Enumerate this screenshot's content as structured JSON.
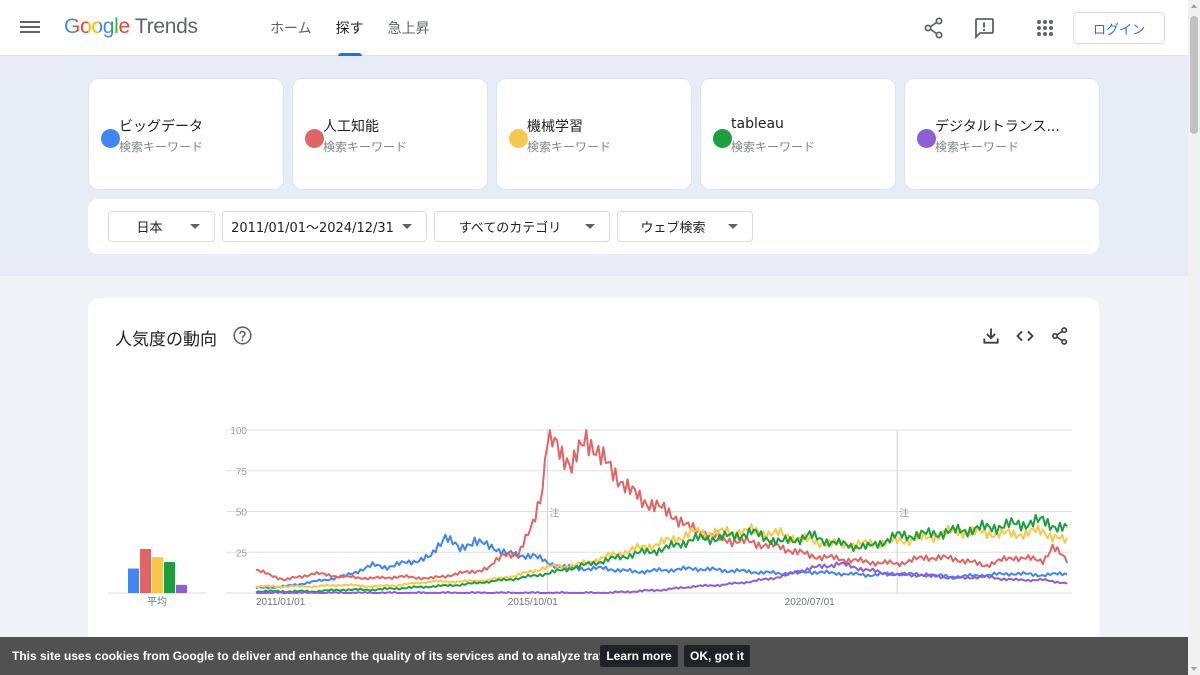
{
  "header": {
    "logo_google": "Google",
    "logo_trends": "Trends",
    "nav": [
      {
        "label": "ホーム"
      },
      {
        "label": "探す"
      },
      {
        "label": "急上昇"
      }
    ],
    "login_label": "ログイン"
  },
  "terms": [
    {
      "name": "ビッグデータ",
      "sub": "検索キーワード",
      "color": "#4285f4"
    },
    {
      "name": "人工知能",
      "sub": "検索キーワード",
      "color": "#e06666"
    },
    {
      "name": "機械学習",
      "sub": "検索キーワード",
      "color": "#f6c94e"
    },
    {
      "name": "tableau",
      "sub": "検索キーワード",
      "color": "#1e9e3e"
    },
    {
      "name": "デジタルトランス...",
      "sub": "検索キーワード",
      "color": "#8c5fd3"
    }
  ],
  "filters": {
    "region": "日本",
    "date_range": "2011/01/01～2024/12/31",
    "category": "すべてのカテゴリ",
    "search_type": "ウェブ検索"
  },
  "chart_card": {
    "title": "人気度の動向"
  },
  "chart_data": {
    "type": "line",
    "y_ticks": [
      "100",
      "75",
      "50",
      "25"
    ],
    "x_tick_labels": [
      "2011/01/01",
      "2015/10/01",
      "2020/07/01"
    ],
    "ylim": [
      0,
      100
    ],
    "grid": true,
    "notes": [
      {
        "label": "注",
        "date": "2016/01"
      },
      {
        "label": "注",
        "date": "2022/01"
      }
    ],
    "average_label": "平均",
    "averages": [
      {
        "series": "ビッグデータ",
        "value": 15
      },
      {
        "series": "人工知能",
        "value": 27
      },
      {
        "series": "機械学習",
        "value": 22
      },
      {
        "series": "tableau",
        "value": 19
      },
      {
        "series": "デジタルトランス...",
        "value": 5
      }
    ],
    "series": [
      {
        "name": "ビッグデータ",
        "color": "#4285f4",
        "points": [
          [
            "2011/01",
            3
          ],
          [
            "2011/07",
            4
          ],
          [
            "2012/01",
            7
          ],
          [
            "2012/07",
            10
          ],
          [
            "2013/01",
            17
          ],
          [
            "2013/04",
            16
          ],
          [
            "2013/07",
            18
          ],
          [
            "2014/01",
            22
          ],
          [
            "2014/04",
            36
          ],
          [
            "2014/07",
            26
          ],
          [
            "2014/10",
            33
          ],
          [
            "2015/01",
            28
          ],
          [
            "2015/04",
            26
          ],
          [
            "2015/07",
            22
          ],
          [
            "2015/10",
            24
          ],
          [
            "2016/01",
            18
          ],
          [
            "2016/07",
            15
          ],
          [
            "2017/01",
            15
          ],
          [
            "2017/07",
            13
          ],
          [
            "2018/01",
            14
          ],
          [
            "2018/07",
            15
          ],
          [
            "2019/01",
            14
          ],
          [
            "2019/07",
            13
          ],
          [
            "2020/01",
            12
          ],
          [
            "2020/07",
            13
          ],
          [
            "2021/01",
            12
          ],
          [
            "2021/07",
            11
          ],
          [
            "2022/01",
            12
          ],
          [
            "2022/07",
            11
          ],
          [
            "2023/01",
            10
          ],
          [
            "2023/07",
            11
          ],
          [
            "2024/01",
            12
          ],
          [
            "2024/07",
            11
          ],
          [
            "2024/12",
            12
          ]
        ]
      },
      {
        "name": "人工知能",
        "color": "#e06666",
        "points": [
          [
            "2011/01",
            14
          ],
          [
            "2011/07",
            8
          ],
          [
            "2012/01",
            12
          ],
          [
            "2012/07",
            10
          ],
          [
            "2013/01",
            9
          ],
          [
            "2013/07",
            10
          ],
          [
            "2014/01",
            9
          ],
          [
            "2014/07",
            12
          ],
          [
            "2015/01",
            15
          ],
          [
            "2015/04",
            25
          ],
          [
            "2015/07",
            22
          ],
          [
            "2015/10",
            45
          ],
          [
            "2015/12",
            62
          ],
          [
            "2016/01",
            92
          ],
          [
            "2016/03",
            94
          ],
          [
            "2016/06",
            75
          ],
          [
            "2016/09",
            98
          ],
          [
            "2016/12",
            82
          ],
          [
            "2017/03",
            74
          ],
          [
            "2017/06",
            62
          ],
          [
            "2017/09",
            57
          ],
          [
            "2017/12",
            52
          ],
          [
            "2018/03",
            48
          ],
          [
            "2018/06",
            40
          ],
          [
            "2018/09",
            37
          ],
          [
            "2019/01",
            33
          ],
          [
            "2019/07",
            31
          ],
          [
            "2020/01",
            28
          ],
          [
            "2020/07",
            23
          ],
          [
            "2021/01",
            21
          ],
          [
            "2021/07",
            19
          ],
          [
            "2022/01",
            18
          ],
          [
            "2022/07",
            22
          ],
          [
            "2023/01",
            21
          ],
          [
            "2023/07",
            17
          ],
          [
            "2024/01",
            22
          ],
          [
            "2024/07",
            20
          ],
          [
            "2024/09",
            28
          ],
          [
            "2024/12",
            20
          ]
        ]
      },
      {
        "name": "機械学習",
        "color": "#f6c94e",
        "points": [
          [
            "2011/01",
            4
          ],
          [
            "2011/07",
            4
          ],
          [
            "2012/01",
            4
          ],
          [
            "2012/07",
            5
          ],
          [
            "2013/01",
            4
          ],
          [
            "2013/07",
            5
          ],
          [
            "2014/01",
            7
          ],
          [
            "2014/07",
            7
          ],
          [
            "2015/01",
            8
          ],
          [
            "2015/07",
            11
          ],
          [
            "2016/01",
            16
          ],
          [
            "2016/07",
            17
          ],
          [
            "2017/01",
            22
          ],
          [
            "2017/07",
            27
          ],
          [
            "2018/01",
            31
          ],
          [
            "2018/07",
            37
          ],
          [
            "2019/01",
            37
          ],
          [
            "2019/07",
            38
          ],
          [
            "2020/01",
            36
          ],
          [
            "2020/07",
            32
          ],
          [
            "2021/01",
            30
          ],
          [
            "2021/07",
            30
          ],
          [
            "2022/01",
            32
          ],
          [
            "2022/07",
            34
          ],
          [
            "2023/01",
            38
          ],
          [
            "2023/07",
            37
          ],
          [
            "2024/01",
            36
          ],
          [
            "2024/07",
            38
          ],
          [
            "2024/12",
            31
          ]
        ]
      },
      {
        "name": "tableau",
        "color": "#1e9e3e",
        "points": [
          [
            "2011/01",
            1
          ],
          [
            "2011/07",
            1
          ],
          [
            "2012/01",
            1
          ],
          [
            "2012/07",
            2
          ],
          [
            "2013/01",
            2
          ],
          [
            "2013/07",
            3
          ],
          [
            "2014/01",
            4
          ],
          [
            "2014/07",
            5
          ],
          [
            "2015/01",
            7
          ],
          [
            "2015/07",
            9
          ],
          [
            "2016/01",
            12
          ],
          [
            "2016/07",
            16
          ],
          [
            "2017/01",
            20
          ],
          [
            "2017/07",
            24
          ],
          [
            "2018/01",
            27
          ],
          [
            "2018/07",
            33
          ],
          [
            "2019/01",
            34
          ],
          [
            "2019/07",
            37
          ],
          [
            "2020/01",
            31
          ],
          [
            "2020/07",
            35
          ],
          [
            "2021/01",
            30
          ],
          [
            "2021/07",
            28
          ],
          [
            "2022/01",
            35
          ],
          [
            "2022/07",
            36
          ],
          [
            "2023/01",
            38
          ],
          [
            "2023/07",
            40
          ],
          [
            "2024/01",
            42
          ],
          [
            "2024/07",
            44
          ],
          [
            "2024/12",
            39
          ]
        ]
      },
      {
        "name": "デジタルトランス...",
        "color": "#8c5fd3",
        "points": [
          [
            "2011/01",
            0
          ],
          [
            "2012/01",
            0
          ],
          [
            "2013/01",
            0
          ],
          [
            "2014/01",
            0
          ],
          [
            "2015/01",
            0
          ],
          [
            "2016/01",
            0
          ],
          [
            "2017/01",
            0
          ],
          [
            "2017/07",
            1
          ],
          [
            "2018/01",
            2
          ],
          [
            "2018/07",
            4
          ],
          [
            "2019/01",
            5
          ],
          [
            "2019/07",
            7
          ],
          [
            "2020/01",
            10
          ],
          [
            "2020/07",
            15
          ],
          [
            "2021/01",
            18
          ],
          [
            "2021/07",
            14
          ],
          [
            "2022/01",
            11
          ],
          [
            "2022/07",
            11
          ],
          [
            "2023/01",
            9
          ],
          [
            "2023/07",
            10
          ],
          [
            "2024/01",
            8
          ],
          [
            "2024/07",
            8
          ],
          [
            "2024/12",
            6
          ]
        ]
      }
    ]
  },
  "cookie": {
    "text": "This site uses cookies from Google to deliver and enhance the quality of its services and to analyze traffic.",
    "learn_more": "Learn more",
    "ok": "OK, got it"
  }
}
